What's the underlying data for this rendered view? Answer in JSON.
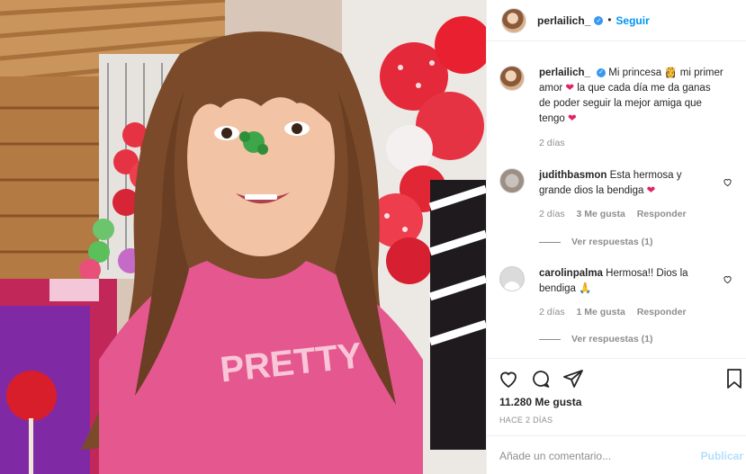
{
  "post": {
    "username": "perlailich_",
    "follow_label": "Seguir",
    "separator": "•"
  },
  "caption": {
    "username": "perlailich_",
    "text_1": " Mi princesa ",
    "text_2": " mi primer amor ",
    "text_3": " la que cada día me da ganas de poder seguir la mejor amiga que tengo ",
    "time": "2 días"
  },
  "comments": [
    {
      "username": "judithbasmon",
      "text": " Esta hermosa y grande dios la bendiga ",
      "time": "2 días",
      "likes": "3 Me gusta",
      "reply_label": "Responder",
      "view_replies": "Ver respuestas (1)"
    },
    {
      "username": "carolinpalma",
      "text": " Hermosa!! Dios la bendiga ",
      "time": "2 días",
      "likes": "1 Me gusta",
      "reply_label": "Responder",
      "view_replies": "Ver respuestas (1)"
    }
  ],
  "stats": {
    "likes": "11.280 Me gusta",
    "posted": "HACE 2 DÍAS"
  },
  "composer": {
    "placeholder": "Añade un comentario...",
    "publish_label": "Publicar"
  },
  "photo": {
    "shirt_text": "PRETTY"
  },
  "colors": {
    "link": "#0095f6",
    "verified": "#3897f0",
    "heart": "#ed4956",
    "muted": "#8e8e8e"
  },
  "icons": [
    "verified-icon",
    "heart-icon",
    "comment-icon",
    "share-icon",
    "bookmark-icon",
    "red-heart-emoji",
    "princess-emoji",
    "pray-emoji"
  ]
}
